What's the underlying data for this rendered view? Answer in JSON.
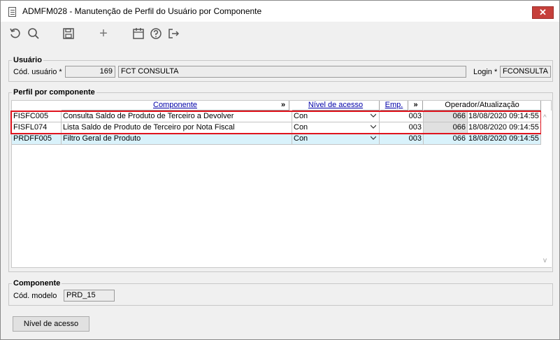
{
  "window": {
    "title": "ADMFM028 - Manutenção de Perfil do Usuário por Componente",
    "close_glyph": "✕"
  },
  "toolbar": {
    "icons": [
      "refresh-icon",
      "search-icon",
      "save-icon",
      "add-icon",
      "calendar-icon",
      "help-icon",
      "exit-icon"
    ],
    "add_glyph": "+"
  },
  "usuario": {
    "legend": "Usuário",
    "cod_label": "Cód. usuário *",
    "cod_value": "169",
    "name_value": "FCT CONSULTA",
    "login_label": "Login *",
    "login_value": "FCONSULTA"
  },
  "perfil": {
    "legend": "Perfil por componente",
    "headers": {
      "componente": "Componente",
      "expand1": "»",
      "nivel": "Nível de acesso",
      "emp": "Emp.",
      "expand2": "»",
      "operador": "Operador/Atualização"
    },
    "rows": [
      {
        "code": "FISFC005",
        "desc": "Consulta Saldo de Produto de Terceiro a Devolver",
        "nivel": "Con",
        "emp": "003",
        "operador": "066",
        "data": "18/08/2020 09:14:55"
      },
      {
        "code": "FISFL074",
        "desc": "Lista Saldo de Produto de Terceiro por Nota Fiscal",
        "nivel": "Con",
        "emp": "003",
        "operador": "066",
        "data": "18/08/2020 09:14:55"
      },
      {
        "code": "PRDFF005",
        "desc": "Filtro Geral de Produto",
        "nivel": "Con",
        "emp": "003",
        "operador": "066",
        "data": "18/08/2020 09:14:55"
      }
    ],
    "scroll_up": "^",
    "scroll_down": "v"
  },
  "componente": {
    "legend": "Componente",
    "modelo_label": "Cód. modelo",
    "modelo_value": "PRD_15"
  },
  "actions": {
    "nivel_acesso_label": "Nível de acesso"
  },
  "colors": {
    "highlight": "#e0141e",
    "selected_row": "#d9f2fb",
    "header_link": "#0000a8",
    "close_button": "#c6403b"
  }
}
